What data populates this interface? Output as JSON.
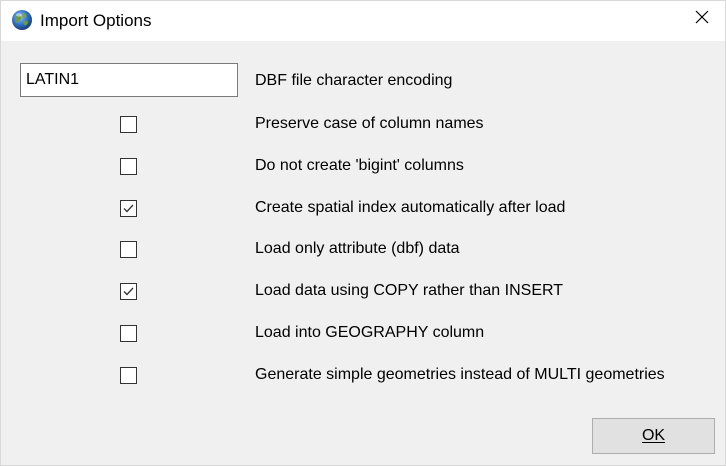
{
  "window": {
    "title": "Import Options",
    "app_icon": "globe-icon",
    "close_icon": "close-icon"
  },
  "encoding": {
    "value": "LATIN1",
    "label": "DBF file character encoding"
  },
  "options": [
    {
      "label": "Preserve case of column names",
      "checked": false
    },
    {
      "label": "Do not create 'bigint' columns",
      "checked": false
    },
    {
      "label": "Create spatial index automatically after load",
      "checked": true
    },
    {
      "label": "Load only attribute (dbf) data",
      "checked": false
    },
    {
      "label": "Load data using COPY rather than INSERT",
      "checked": true
    },
    {
      "label": "Load into GEOGRAPHY column",
      "checked": false
    },
    {
      "label": "Generate simple geometries instead of MULTI geometries",
      "checked": false
    }
  ],
  "footer": {
    "ok_label": "OK"
  },
  "colors": {
    "window_bg": "#f0f0f0",
    "titlebar_bg": "#ffffff",
    "button_bg": "#e1e1e1",
    "button_border": "#adadad"
  }
}
